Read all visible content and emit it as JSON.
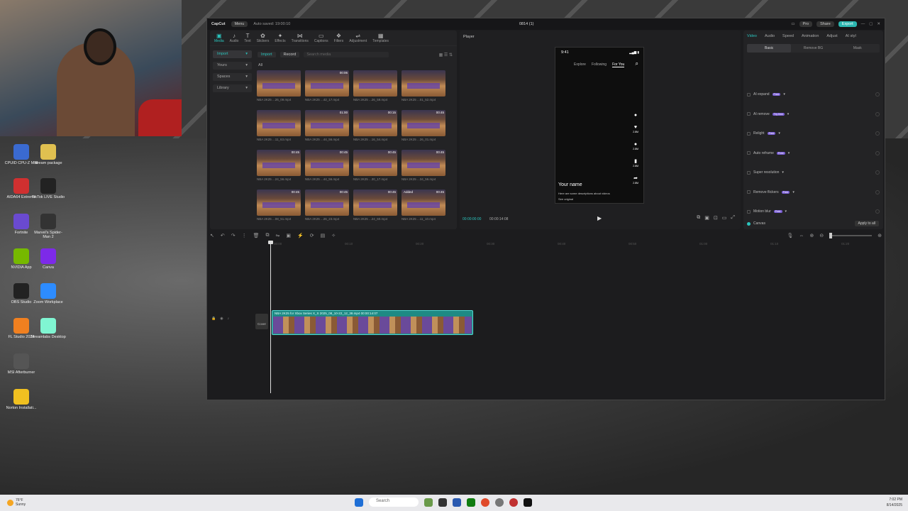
{
  "desktop_icons": [
    {
      "label": "CPUID CPU-Z MSI",
      "color": "#3a6ad0"
    },
    {
      "label": "stream package",
      "color": "#e0c050"
    },
    {
      "label": "AIDA64 Extreme",
      "color": "#d03030"
    },
    {
      "label": "TikTok LIVE Studio",
      "color": "#222"
    },
    {
      "label": "Fortnite",
      "color": "#6a4ad0"
    },
    {
      "label": "Marvel's Spider-Man 2",
      "color": "#333"
    },
    {
      "label": "NVIDIA App",
      "color": "#76b900"
    },
    {
      "label": "Canva",
      "color": "#7d2ae8"
    },
    {
      "label": "OBS Studio",
      "color": "#222"
    },
    {
      "label": "Zoom Workplace",
      "color": "#2d8cff"
    },
    {
      "label": "FL Studio 2024",
      "color": "#f08020"
    },
    {
      "label": "Streamlabs Desktop",
      "color": "#80f5d2"
    },
    {
      "label": "MSI Afterburner",
      "color": "#555"
    },
    {
      "label": "Norton Installati...",
      "color": "#f0c020"
    }
  ],
  "app": {
    "logo": "CapCut",
    "menu": "Menu",
    "autosave": "Auto saved: 19:00:10",
    "project": "0814 (1)",
    "pro": "Pro",
    "share": "Share",
    "export": "Export"
  },
  "toolbar": [
    {
      "icon": "▣",
      "label": "Media"
    },
    {
      "icon": "♪",
      "label": "Audio"
    },
    {
      "icon": "T",
      "label": "Text"
    },
    {
      "icon": "✿",
      "label": "Stickers"
    },
    {
      "icon": "✦",
      "label": "Effects"
    },
    {
      "icon": "⋈",
      "label": "Transitions"
    },
    {
      "icon": "▭",
      "label": "Captions"
    },
    {
      "icon": "❖",
      "label": "Filters"
    },
    {
      "icon": "⇌",
      "label": "Adjustment"
    },
    {
      "icon": "▦",
      "label": "Templates"
    }
  ],
  "leftnav": [
    "Import",
    "Yours",
    "Spaces",
    "Library"
  ],
  "media": {
    "import_btn": "Import",
    "record_btn": "Record",
    "search_placeholder": "Search media",
    "all_label": "All"
  },
  "thumbs": [
    {
      "dur": "",
      "cap": "NBA 2K25 ...26_09.mp4"
    },
    {
      "dur": "00:06",
      "cap": "NBA 2K25 ...42_17.mp4"
    },
    {
      "dur": "",
      "cap": "NBA 2K25 ...26_59.mp4"
    },
    {
      "dur": "",
      "cap": "NBA 2K25 ...01_52.mp4"
    },
    {
      "dur": "",
      "cap": "NBA 2K25 ...11_63.mp4"
    },
    {
      "dur": "01:00",
      "cap": "NBA 2K25 ...44_56.mp4"
    },
    {
      "dur": "00:15",
      "cap": "NBA 2K25 ...16_54.mp4"
    },
    {
      "dur": "00:45",
      "cap": "NBA 2K25 ...26_01.mp4"
    },
    {
      "dur": "00:45",
      "cap": "NBA 2K25 ...24_56.mp4"
    },
    {
      "dur": "00:45",
      "cap": "NBA 2K25 ...44_56.mp4"
    },
    {
      "dur": "00:45",
      "cap": "NBA 2K25 ...30_17.mp4"
    },
    {
      "dur": "00:45",
      "cap": "NBA 2K25 ...34_56.mp4"
    },
    {
      "dur": "00:45",
      "cap": "NBA 2K25 ...08_51.mp4"
    },
    {
      "dur": "00:45",
      "cap": "NBA 2K25 ...26_23.mp4"
    },
    {
      "dur": "00:45",
      "cap": "NBA 2K25 ...24_60.mp4"
    },
    {
      "dur": "00:45",
      "cap": "NBA 2K25 ...11_10.mp4",
      "added": "Added"
    }
  ],
  "player": {
    "label": "Player",
    "time": "9:41",
    "tabs": [
      "Explore",
      "Following",
      "For You"
    ],
    "side": [
      {
        "i": "♥",
        "n": "2.8M"
      },
      {
        "i": "●",
        "n": "2.8M"
      },
      {
        "i": "▮",
        "n": "2.8M"
      },
      {
        "i": "➦",
        "n": "2.8M"
      }
    ],
    "name": "Your name",
    "desc": "Here are some descriptions about videos",
    "orig": "See original",
    "current": "00:00:00:00",
    "total": "00:00:14:08"
  },
  "props": {
    "tabs": [
      "Video",
      "Audio",
      "Speed",
      "Animation",
      "Adjust",
      "AI styl"
    ],
    "subtabs": [
      "Basic",
      "Remove BG",
      "Mask"
    ],
    "rows": [
      {
        "label": "AI expand",
        "badge": "Free"
      },
      {
        "label": "AI remove",
        "badge": "Try free"
      },
      {
        "label": "Relight",
        "badge": "Free"
      },
      {
        "label": "Auto reframe",
        "badge": "Free"
      },
      {
        "label": "Super resolution",
        "badge": ""
      },
      {
        "label": "Remove flickers",
        "badge": "Free"
      },
      {
        "label": "Motion blur",
        "badge": "Free"
      }
    ],
    "canvas": "Canvas",
    "apply_all": "Apply to all"
  },
  "timeline": {
    "ruler": [
      "00:00",
      "00:10",
      "00:20",
      "00:30",
      "00:40",
      "00:50",
      "01:00",
      "01:10",
      "01:20"
    ],
    "cover": "Cover",
    "clip_caption": "NBA 2K25 for Xbox Series X_S 2025_08_10-22_12_38.mp4  00:00:14:07"
  },
  "taskbar": {
    "weather_temp": "76°F",
    "weather_cond": "Sunny",
    "search": "Search",
    "time": "7:02 PM",
    "date": "8/14/2025"
  }
}
